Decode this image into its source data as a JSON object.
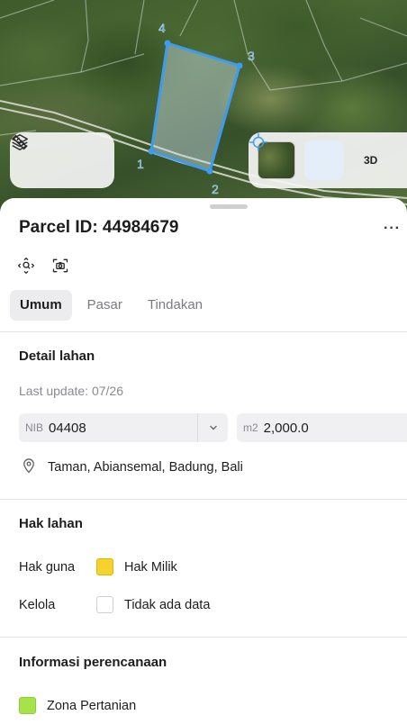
{
  "map": {
    "vertex_labels": [
      "1",
      "2",
      "3",
      "4"
    ],
    "view_3d_label": "3D",
    "icons": {
      "layers": "layers-icon",
      "measure": "ruler-icon",
      "basemap": "satellite-thumbnail",
      "locate": "crosshair-icon"
    }
  },
  "sheet": {
    "title": "Parcel ID: 44984679",
    "more_label": "···",
    "tabs": [
      {
        "label": "Umum",
        "active": true
      },
      {
        "label": "Pasar",
        "active": false
      },
      {
        "label": "Tindakan",
        "active": false
      }
    ]
  },
  "detail": {
    "title": "Detail lahan",
    "last_update": "Last update: 07/26",
    "nib_label": "NIB",
    "nib_value": "04408",
    "area_label": "m2",
    "area_value": "2,000.0",
    "address": "Taman, Abiansemal, Badung, Bali"
  },
  "rights": {
    "title": "Hak lahan",
    "rows": [
      {
        "label": "Hak guna",
        "value": "Hak Milik",
        "color": "#f7d22e"
      },
      {
        "label": "Kelola",
        "value": "Tidak ada data",
        "color": "#ffffff"
      }
    ]
  },
  "planning": {
    "title": "Informasi perencanaan",
    "zone": "Zona Pertanian",
    "zone_color": "#a6e34a"
  }
}
